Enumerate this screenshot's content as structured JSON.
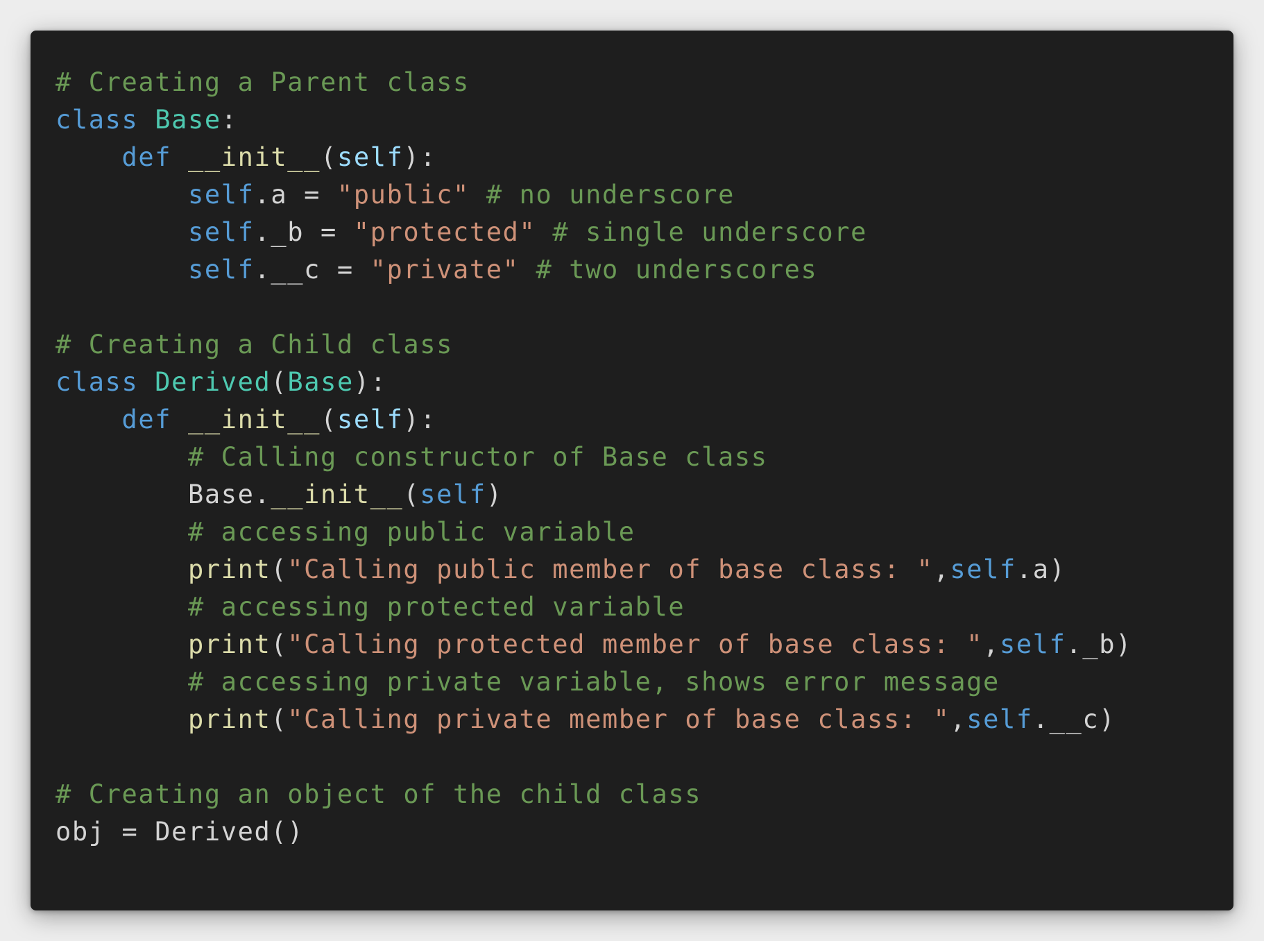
{
  "code": {
    "language": "python",
    "theme_colors": {
      "background": "#1e1e1e",
      "comment": "#6a9955",
      "keyword": "#569cd6",
      "class": "#4ec9b0",
      "function": "#dcdcaa",
      "string": "#ce9178",
      "parameter": "#9cdcfe",
      "text": "#d4d4d4"
    },
    "lines": [
      [
        {
          "t": "cmt",
          "v": "# Creating a Parent class"
        }
      ],
      [
        {
          "t": "kw",
          "v": "class"
        },
        {
          "t": "plain",
          "v": " "
        },
        {
          "t": "cls",
          "v": "Base"
        },
        {
          "t": "plain",
          "v": ":"
        }
      ],
      [
        {
          "t": "plain",
          "v": "    "
        },
        {
          "t": "kw",
          "v": "def"
        },
        {
          "t": "plain",
          "v": " "
        },
        {
          "t": "fn",
          "v": "__init__"
        },
        {
          "t": "plain",
          "v": "("
        },
        {
          "t": "param",
          "v": "self"
        },
        {
          "t": "plain",
          "v": "):"
        }
      ],
      [
        {
          "t": "plain",
          "v": "        "
        },
        {
          "t": "kw",
          "v": "self"
        },
        {
          "t": "plain",
          "v": ".a = "
        },
        {
          "t": "str",
          "v": "\"public\""
        },
        {
          "t": "plain",
          "v": " "
        },
        {
          "t": "cmt",
          "v": "# no underscore"
        }
      ],
      [
        {
          "t": "plain",
          "v": "        "
        },
        {
          "t": "kw",
          "v": "self"
        },
        {
          "t": "plain",
          "v": "._b = "
        },
        {
          "t": "str",
          "v": "\"protected\""
        },
        {
          "t": "plain",
          "v": " "
        },
        {
          "t": "cmt",
          "v": "# single underscore"
        }
      ],
      [
        {
          "t": "plain",
          "v": "        "
        },
        {
          "t": "kw",
          "v": "self"
        },
        {
          "t": "plain",
          "v": ".__c = "
        },
        {
          "t": "str",
          "v": "\"private\""
        },
        {
          "t": "plain",
          "v": " "
        },
        {
          "t": "cmt",
          "v": "# two underscores"
        }
      ],
      [],
      [
        {
          "t": "cmt",
          "v": "# Creating a Child class"
        }
      ],
      [
        {
          "t": "kw",
          "v": "class"
        },
        {
          "t": "plain",
          "v": " "
        },
        {
          "t": "cls",
          "v": "Derived"
        },
        {
          "t": "plain",
          "v": "("
        },
        {
          "t": "cls",
          "v": "Base"
        },
        {
          "t": "plain",
          "v": "):"
        }
      ],
      [
        {
          "t": "plain",
          "v": "    "
        },
        {
          "t": "kw",
          "v": "def"
        },
        {
          "t": "plain",
          "v": " "
        },
        {
          "t": "fn",
          "v": "__init__"
        },
        {
          "t": "plain",
          "v": "("
        },
        {
          "t": "param",
          "v": "self"
        },
        {
          "t": "plain",
          "v": "):"
        }
      ],
      [
        {
          "t": "plain",
          "v": "        "
        },
        {
          "t": "cmt",
          "v": "# Calling constructor of Base class"
        }
      ],
      [
        {
          "t": "plain",
          "v": "        Base."
        },
        {
          "t": "fn",
          "v": "__init__"
        },
        {
          "t": "plain",
          "v": "("
        },
        {
          "t": "kw",
          "v": "self"
        },
        {
          "t": "plain",
          "v": ")"
        }
      ],
      [
        {
          "t": "plain",
          "v": "        "
        },
        {
          "t": "cmt",
          "v": "# accessing public variable"
        }
      ],
      [
        {
          "t": "plain",
          "v": "        "
        },
        {
          "t": "fn",
          "v": "print"
        },
        {
          "t": "plain",
          "v": "("
        },
        {
          "t": "str",
          "v": "\"Calling public member of base class: \""
        },
        {
          "t": "plain",
          "v": ","
        },
        {
          "t": "kw",
          "v": "self"
        },
        {
          "t": "plain",
          "v": ".a)"
        }
      ],
      [
        {
          "t": "plain",
          "v": "        "
        },
        {
          "t": "cmt",
          "v": "# accessing protected variable"
        }
      ],
      [
        {
          "t": "plain",
          "v": "        "
        },
        {
          "t": "fn",
          "v": "print"
        },
        {
          "t": "plain",
          "v": "("
        },
        {
          "t": "str",
          "v": "\"Calling protected member of base class: \""
        },
        {
          "t": "plain",
          "v": ","
        },
        {
          "t": "kw",
          "v": "self"
        },
        {
          "t": "plain",
          "v": "._b)"
        }
      ],
      [
        {
          "t": "plain",
          "v": "        "
        },
        {
          "t": "cmt",
          "v": "# accessing private variable, shows error message"
        }
      ],
      [
        {
          "t": "plain",
          "v": "        "
        },
        {
          "t": "fn",
          "v": "print"
        },
        {
          "t": "plain",
          "v": "("
        },
        {
          "t": "str",
          "v": "\"Calling private member of base class: \""
        },
        {
          "t": "plain",
          "v": ","
        },
        {
          "t": "kw",
          "v": "self"
        },
        {
          "t": "plain",
          "v": ".__c)"
        }
      ],
      [],
      [
        {
          "t": "cmt",
          "v": "# Creating an object of the child class"
        }
      ],
      [
        {
          "t": "plain",
          "v": "obj = Derived()"
        }
      ]
    ]
  }
}
